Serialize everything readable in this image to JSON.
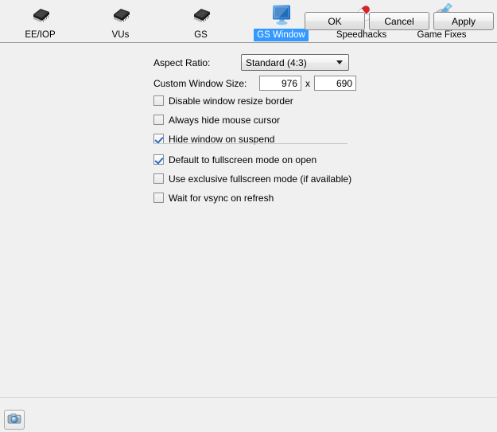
{
  "toolbar": {
    "items": [
      {
        "label": "EE/IOP",
        "icon": "chip-icon",
        "selected": false
      },
      {
        "label": "VUs",
        "icon": "chip-icon",
        "selected": false
      },
      {
        "label": "GS",
        "icon": "chip-icon",
        "selected": false
      },
      {
        "label": "GS Window",
        "icon": "monitor-icon",
        "selected": true
      },
      {
        "label": "Speedhacks",
        "icon": "pills-icon",
        "selected": false
      },
      {
        "label": "Game Fixes",
        "icon": "disc-syringe-icon",
        "selected": false
      }
    ],
    "selected_highlight_color": "#3399ff"
  },
  "form": {
    "aspect_ratio": {
      "label": "Aspect Ratio:",
      "value": "Standard (4:3)",
      "options": [
        "Standard (4:3)"
      ]
    },
    "custom_window_size": {
      "label": "Custom Window Size:",
      "width_value": "976",
      "separator": "x",
      "height_value": "690"
    }
  },
  "checkbox_group_1": [
    {
      "label": "Disable window resize border",
      "checked": false
    },
    {
      "label": "Always hide mouse cursor",
      "checked": false
    },
    {
      "label": "Hide window on suspend",
      "checked": true
    }
  ],
  "checkbox_group_2": [
    {
      "label": "Default to fullscreen mode on open",
      "checked": true
    },
    {
      "label": "Use exclusive fullscreen mode (if available)",
      "checked": false
    },
    {
      "label": "Wait for vsync on refresh",
      "checked": false
    }
  ],
  "footer": {
    "screenshot_button": {
      "icon": "camera-icon",
      "label": ""
    },
    "ok_label": "OK",
    "cancel_label": "Cancel",
    "apply_label": "Apply"
  }
}
